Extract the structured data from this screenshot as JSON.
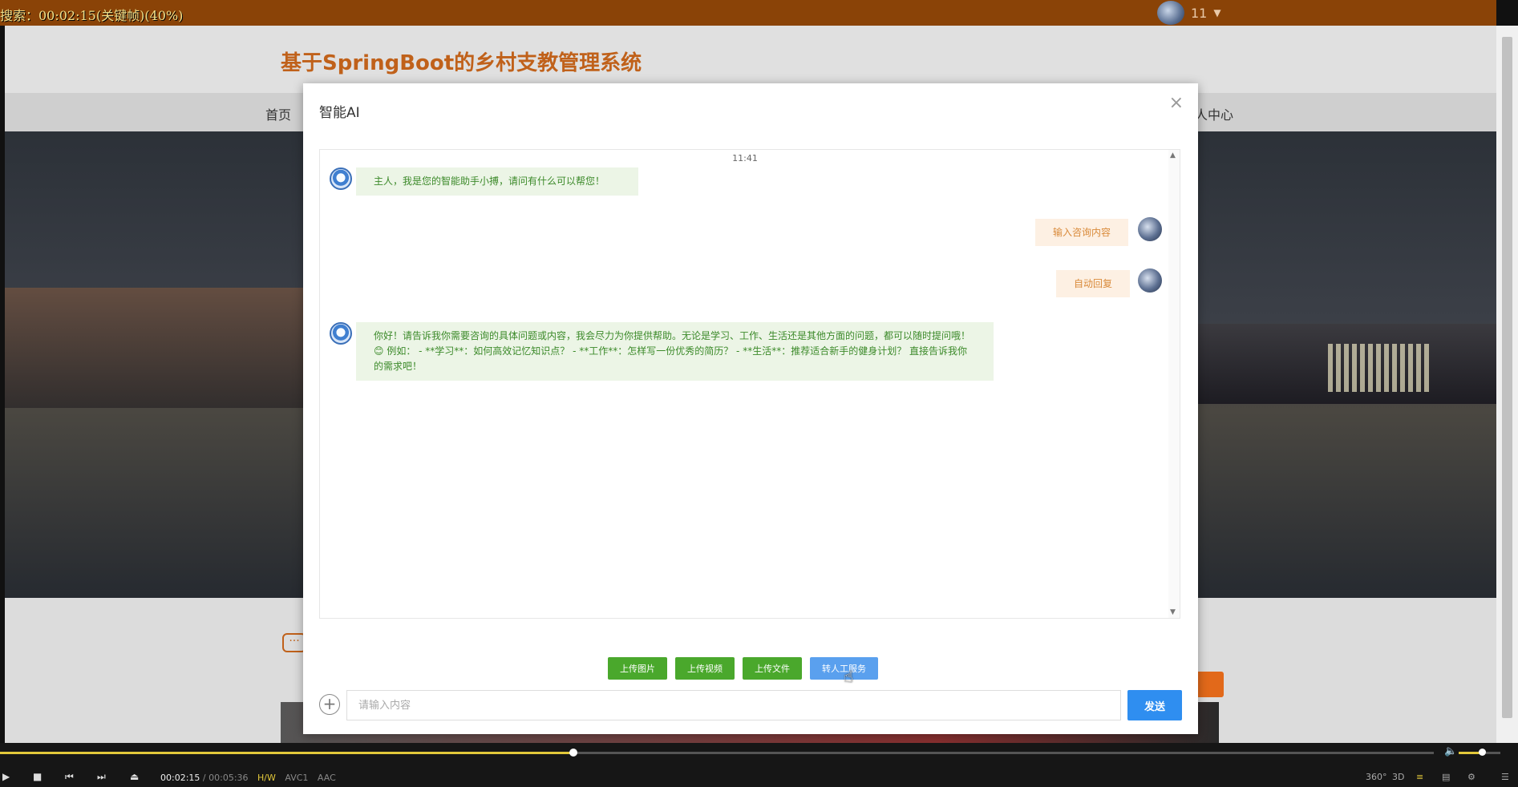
{
  "overlay": {
    "text": "搜索：00:02:15(关键帧)(40%)"
  },
  "top_user": {
    "name": "11"
  },
  "site": {
    "title": "基于SpringBoot的乡村支教管理系统",
    "nav_home": "首页",
    "nav_user_center": "人中心"
  },
  "modal": {
    "title": "智能AI",
    "close_glyph": "×",
    "chat_time": "11:41",
    "messages": [
      {
        "role": "bot",
        "text": "主人，我是您的智能助手小搏，请问有什么可以帮您！"
      },
      {
        "role": "user",
        "text": "输入咨询内容"
      },
      {
        "role": "user",
        "text": "自动回复"
      },
      {
        "role": "bot",
        "text": "你好！请告诉我你需要咨询的具体问题或内容，我会尽力为你提供帮助。无论是学习、工作、生活还是其他方面的问题，都可以随时提问哦！ 😊 例如： - **学习**：如何高效记忆知识点？ - **工作**：怎样写一份优秀的简历？ - **生活**：推荐适合新手的健身计划？ 直接告诉我你的需求吧！"
      }
    ],
    "buttons": {
      "upload_image": "上传图片",
      "upload_video": "上传视频",
      "upload_file": "上传文件",
      "human_service": "转人工服务"
    },
    "input_placeholder": "请输入内容",
    "input_value": "",
    "send_label": "发送"
  },
  "player": {
    "current_time": "00:02:15",
    "separator": "/",
    "total_time": "00:05:36",
    "tag_hw": "H/W",
    "tag_video": "AVC1",
    "tag_audio": "AAC",
    "progress": 0.4,
    "volume": 0.55,
    "right_labels": [
      "360°",
      "3D"
    ]
  },
  "icons": {
    "play": "▶",
    "stop": "■",
    "prev": "⏮",
    "next": "⏭",
    "eject": "⏏",
    "volume": "🔈",
    "plus": "+",
    "scroll_up": "▲",
    "scroll_down": "▼",
    "caret": "▼",
    "chat_float": "···",
    "cursor": "☝"
  }
}
